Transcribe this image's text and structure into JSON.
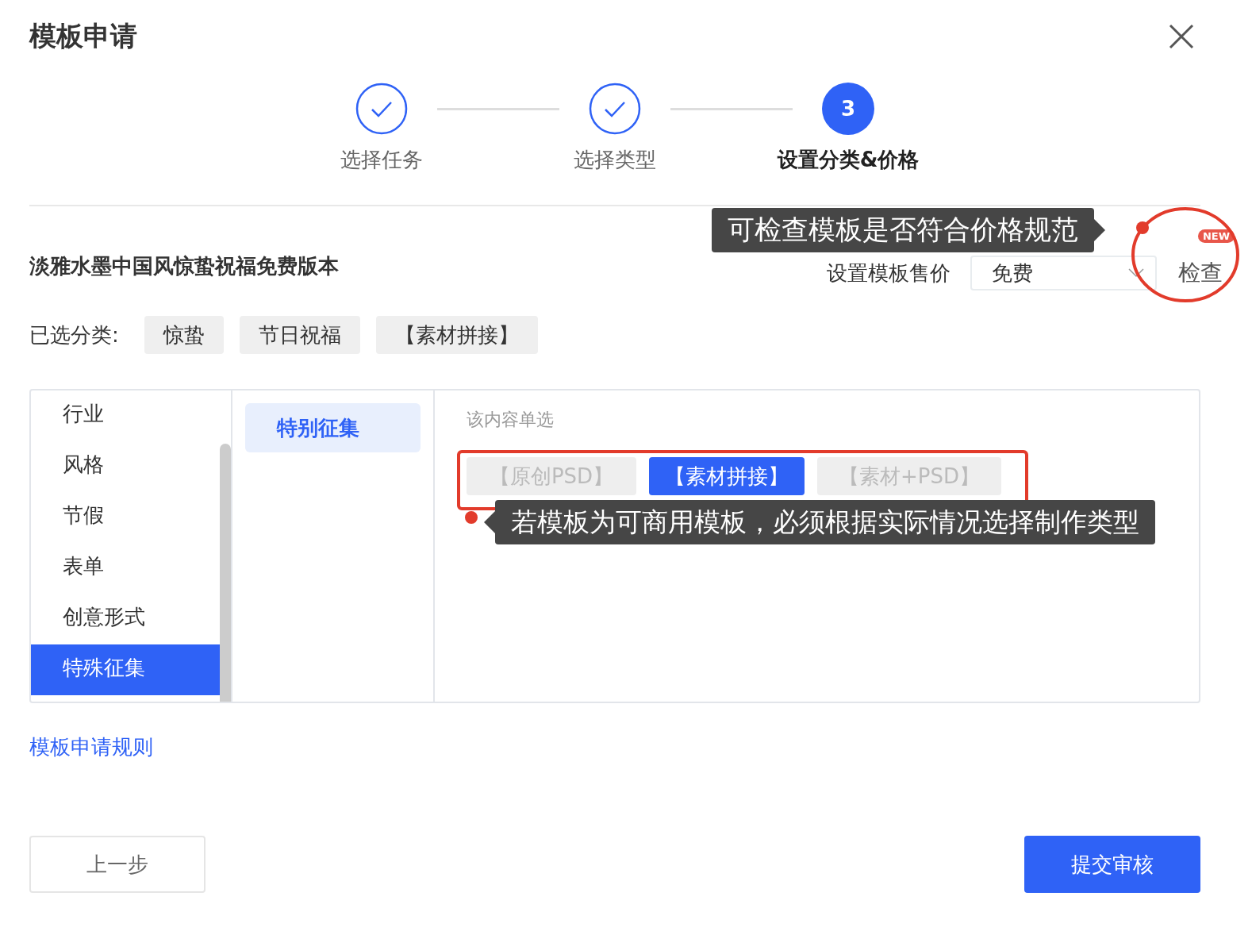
{
  "dialog": {
    "title": "模板申请"
  },
  "steps": [
    {
      "label": "选择任务",
      "kind": "done"
    },
    {
      "label": "选择类型",
      "kind": "done"
    },
    {
      "label": "设置分类&价格",
      "kind": "current",
      "number": "3"
    }
  ],
  "template_name": "淡雅水墨中国风惊蛰祝福免费版本",
  "price": {
    "label": "设置模板售价",
    "value": "免费"
  },
  "check_button": {
    "label": "检查",
    "badge": "NEW"
  },
  "selected_categories": {
    "label": "已选分类:",
    "tags": [
      "惊蛰",
      "节日祝福",
      "【素材拼接】"
    ]
  },
  "category_menu": [
    {
      "label": "行业",
      "selected": false
    },
    {
      "label": "风格",
      "selected": false
    },
    {
      "label": "节假",
      "selected": false
    },
    {
      "label": "表单",
      "selected": false
    },
    {
      "label": "创意形式",
      "selected": false
    },
    {
      "label": "特殊征集",
      "selected": true
    }
  ],
  "subcategories": [
    {
      "label": "特别征集",
      "selected": true
    }
  ],
  "options": {
    "hint": "该内容单选",
    "items": [
      {
        "label": "【原创PSD】",
        "selected": false,
        "disabled": true
      },
      {
        "label": "【素材拼接】",
        "selected": true,
        "disabled": false
      },
      {
        "label": "【素材+PSD】",
        "selected": false,
        "disabled": true
      }
    ]
  },
  "rules_link": "模板申请规则",
  "buttons": {
    "back": "上一步",
    "submit": "提交审核"
  },
  "annotations": [
    {
      "text": "可检查模板是否符合价格规范"
    },
    {
      "text": "若模板为可商用模板，必须根据实际情况选择制作类型"
    }
  ]
}
